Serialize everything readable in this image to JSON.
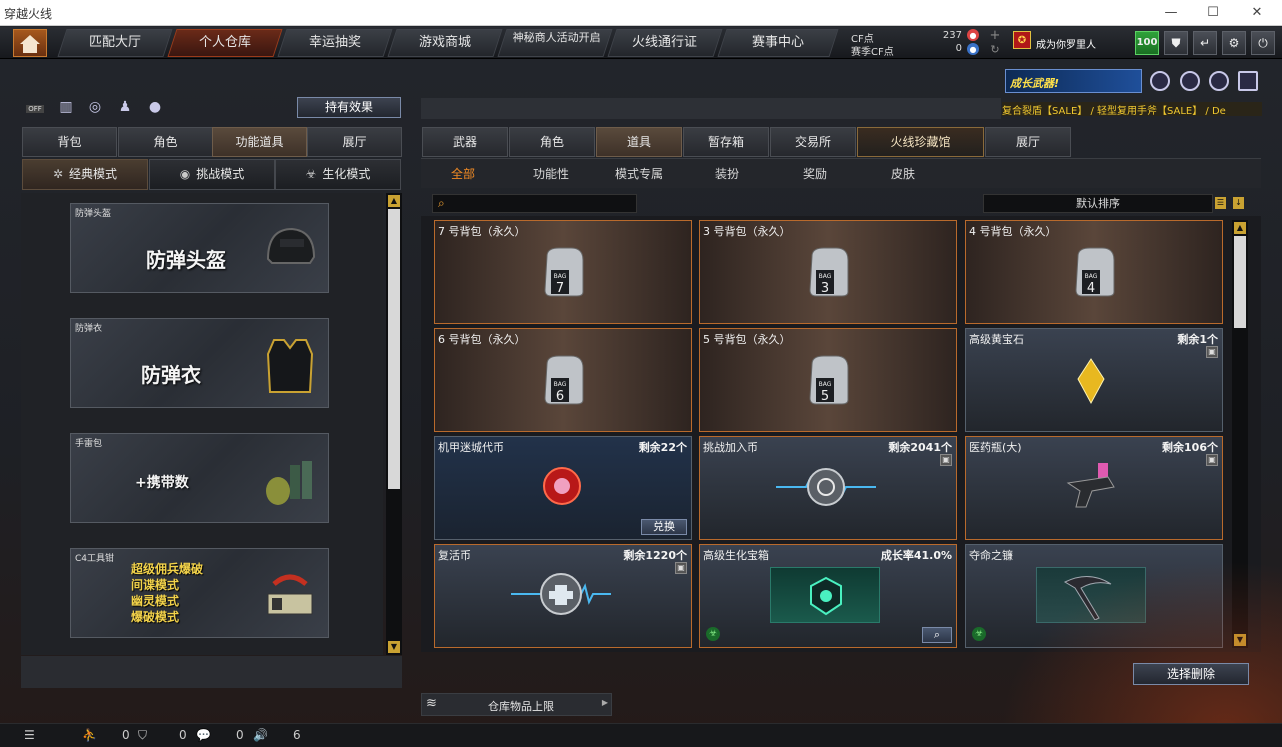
{
  "window": {
    "title": "穿越火线"
  },
  "topnav": {
    "tabs": [
      {
        "label": "匹配大厅"
      },
      {
        "label": "个人仓库"
      },
      {
        "label": "幸运抽奖"
      },
      {
        "label": "游戏商城"
      },
      {
        "label": "神秘商人活动开启"
      },
      {
        "label": "火线通行证"
      },
      {
        "label": "赛事中心"
      }
    ],
    "cf_label": "CF点",
    "cf_value": "237",
    "match_cf_label": "赛季CF点",
    "match_cf_value": "0",
    "username": "成为你罗里人",
    "level_badge": "100"
  },
  "banner": {
    "text": "成长武器!"
  },
  "ticker": {
    "text": "复合裂盾【SALE】 / 轻型复用手斧【SALE】 / De"
  },
  "left": {
    "effect_button": "持有效果",
    "off_label": "OFF",
    "tabs": [
      "背包",
      "角色",
      "功能道具",
      "展厅"
    ],
    "modes": [
      "经典模式",
      "挑战模式",
      "生化模式"
    ],
    "cards": [
      {
        "caption": "防弹头盔",
        "title": "防弹头盔"
      },
      {
        "caption": "防弹衣",
        "title": "防弹衣"
      },
      {
        "caption": "手雷包",
        "title": "+携带数"
      },
      {
        "caption": "C4工具钳",
        "lines": [
          "超级佣兵爆破",
          "间谍模式",
          "幽灵模式",
          "爆破模式"
        ]
      }
    ]
  },
  "right": {
    "tabs": [
      "武器",
      "角色",
      "道具",
      "暂存箱",
      "交易所",
      "火线珍藏馆",
      "展厅"
    ],
    "subtabs": [
      "全部",
      "功能性",
      "模式专属",
      "装扮",
      "奖励",
      "皮肤"
    ],
    "sort_label": "默认排序",
    "items": [
      {
        "name": "7 号背包（永久）",
        "bag": "7"
      },
      {
        "name": "3 号背包（永久）",
        "bag": "3"
      },
      {
        "name": "4 号背包（永久）",
        "bag": "4"
      },
      {
        "name": "6 号背包（永久）",
        "bag": "6"
      },
      {
        "name": "5 号背包（永久）",
        "bag": "5"
      },
      {
        "name": "高级黄宝石",
        "remain": "剩余1个"
      },
      {
        "name": "机甲迷城代币",
        "remain": "剩余22个",
        "button": "兑换"
      },
      {
        "name": "挑战加入币",
        "remain": "剩余2041个"
      },
      {
        "name": "医药瓶(大)",
        "remain": "剩余106个"
      },
      {
        "name": "复活币",
        "remain": "剩余1220个"
      },
      {
        "name": "高级生化宝箱",
        "remain": "成长率41.0%"
      },
      {
        "name": "夺命之镰"
      }
    ],
    "delete_button": "选择删除",
    "storage_label": "仓库物品上限"
  },
  "statusbar": {
    "a": "0",
    "b": "0",
    "c": "0",
    "d": "6"
  },
  "colors": {
    "accent": "#f08a24",
    "border": "#b96a2c",
    "gold": "#c9a232"
  }
}
